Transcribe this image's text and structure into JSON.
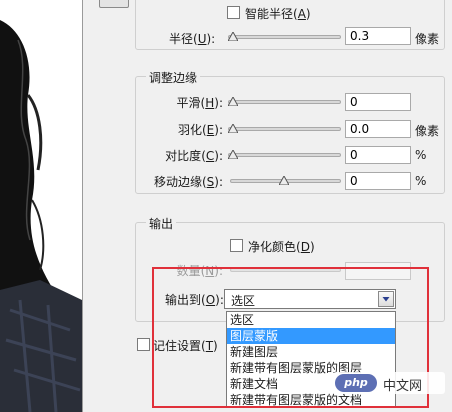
{
  "edge_detection": {
    "smart_radius_label": "智能半径",
    "smart_radius_key": "A",
    "radius_label": "半径",
    "radius_key": "U",
    "radius_value": "0.3",
    "radius_unit": "像素"
  },
  "adjust_edge": {
    "title": "调整边缘",
    "smooth": {
      "label": "平滑",
      "key": "H",
      "value": "0"
    },
    "feather": {
      "label": "羽化",
      "key": "E",
      "value": "0.0",
      "unit": "像素"
    },
    "contrast": {
      "label": "对比度",
      "key": "C",
      "value": "0",
      "unit": "%"
    },
    "shift_edge": {
      "label": "移动边缘",
      "key": "S",
      "value": "0",
      "unit": "%"
    }
  },
  "output": {
    "title": "输出",
    "decontaminate_label": "净化颜色",
    "decontaminate_key": "D",
    "amount_label": "数量",
    "amount_key": "N",
    "output_to_label": "输出到",
    "output_to_key": "O",
    "output_to_value": "选区",
    "options": [
      "选区",
      "图层蒙版",
      "新建图层",
      "新建带有图层蒙版的图层",
      "新建文档",
      "新建带有图层蒙版的文档"
    ]
  },
  "remember_label": "记住设置",
  "remember_key": "T",
  "watermark": {
    "logo_text": "php",
    "text": "中文网"
  },
  "colors": {
    "highlight": "#3399ff",
    "annotation_box": "#e0303a",
    "dialog_bg": "#f0f0f0"
  }
}
